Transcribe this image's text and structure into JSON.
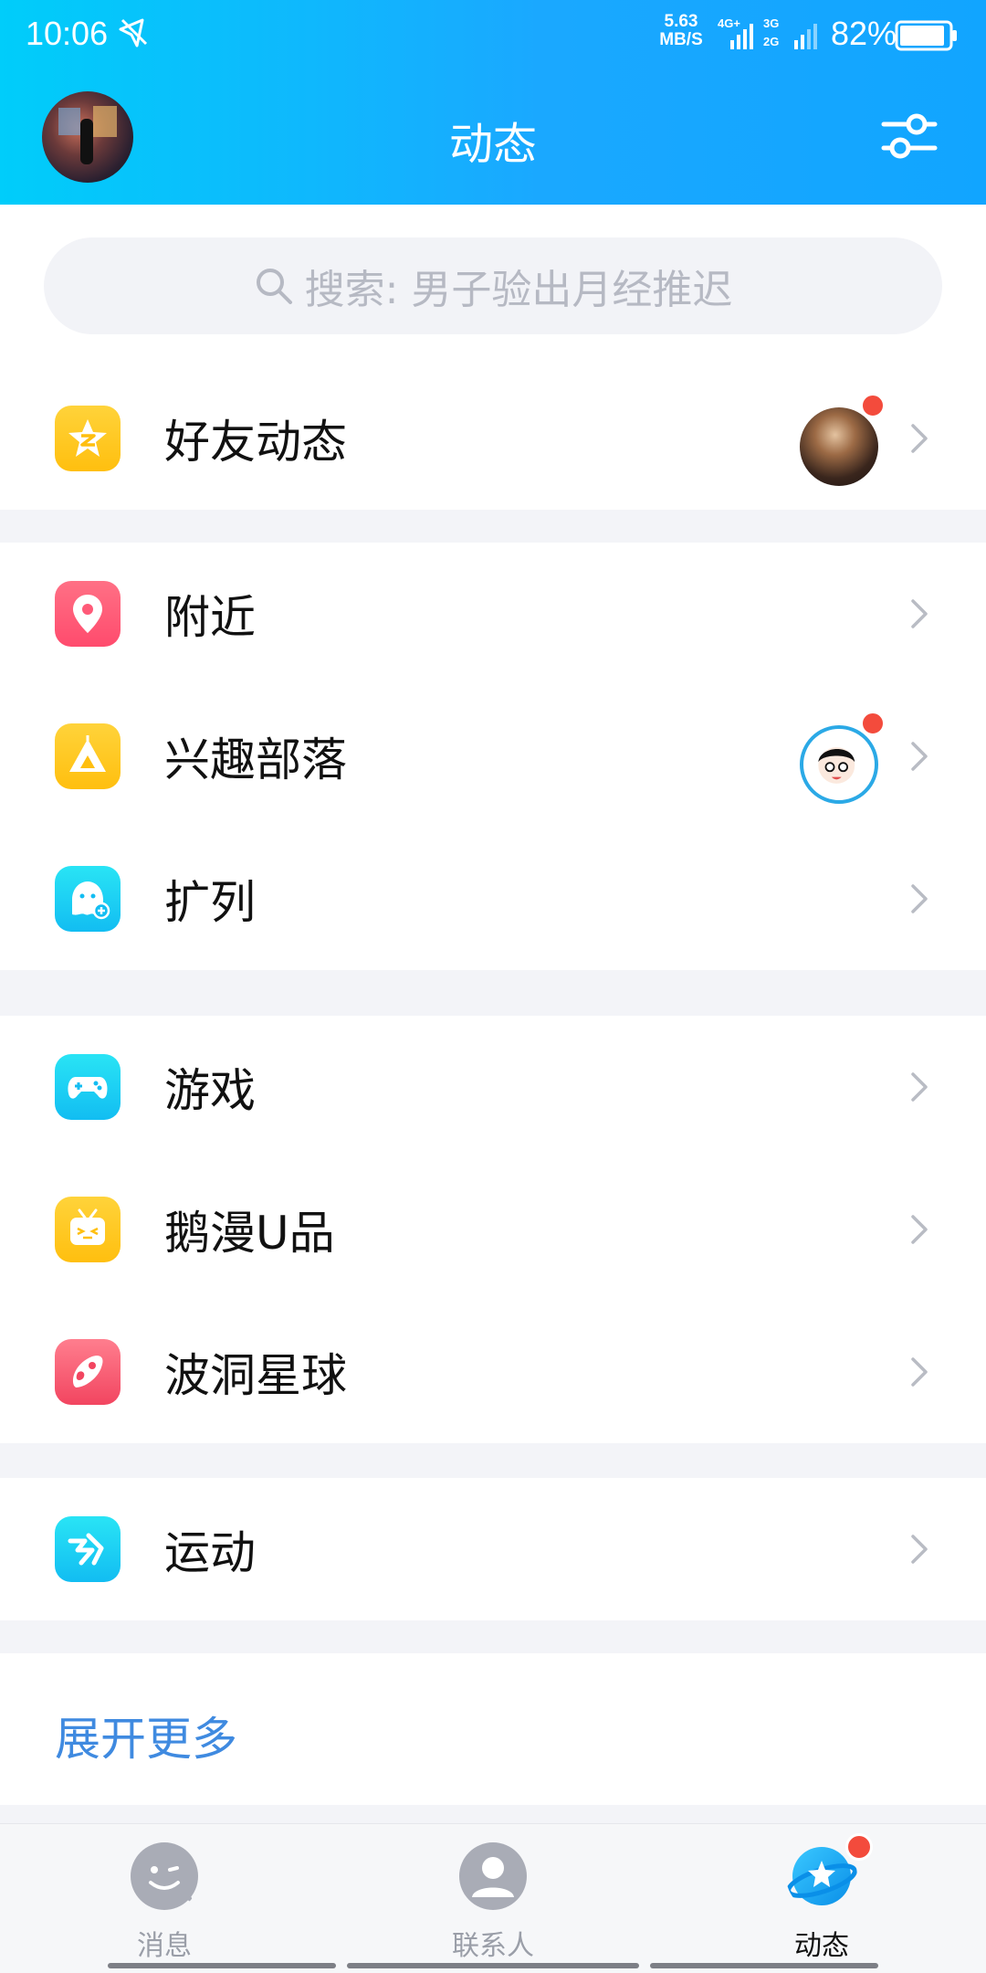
{
  "status_bar": {
    "time": "10:06",
    "speed_value": "5.63",
    "speed_unit": "MB/S",
    "network1": "4G+",
    "network2_top": "3G",
    "network2_bottom": "2G",
    "battery_percent": "82%"
  },
  "header": {
    "title": "动态"
  },
  "search": {
    "placeholder": "搜索: 男子验出月经推迟"
  },
  "groups": [
    {
      "items": [
        {
          "label": "好友动态",
          "icon": "qzone-star-icon",
          "icon_color": "#ffc61f",
          "has_thumb": true,
          "has_badge": true
        }
      ]
    },
    {
      "items": [
        {
          "label": "附近",
          "icon": "location-pin-icon",
          "icon_color": "#ff5a78",
          "has_thumb": false,
          "has_badge": false
        },
        {
          "label": "兴趣部落",
          "icon": "tent-icon",
          "icon_color": "#ffc61f",
          "has_thumb": true,
          "has_badge": true
        },
        {
          "label": "扩列",
          "icon": "ghost-plus-icon",
          "icon_color": "#1ccff4",
          "has_thumb": false,
          "has_badge": false
        }
      ]
    },
    {
      "items": [
        {
          "label": "游戏",
          "icon": "gamepad-icon",
          "icon_color": "#1ccff4",
          "has_thumb": false,
          "has_badge": false
        },
        {
          "label": "鹅漫U品",
          "icon": "tv-face-icon",
          "icon_color": "#ffc61f",
          "has_thumb": false,
          "has_badge": false
        },
        {
          "label": "波洞星球",
          "icon": "planet-rocket-icon",
          "icon_color": "#f5546b",
          "has_thumb": false,
          "has_badge": false
        }
      ]
    },
    {
      "items": [
        {
          "label": "运动",
          "icon": "runner-icon",
          "icon_color": "#1ccff4",
          "has_thumb": false,
          "has_badge": false
        }
      ]
    }
  ],
  "expand": {
    "label": "展开更多"
  },
  "bottom_nav": [
    {
      "label": "消息",
      "icon": "message-face-icon",
      "active": false
    },
    {
      "label": "联系人",
      "icon": "contacts-person-icon",
      "active": false
    },
    {
      "label": "动态",
      "icon": "star-planet-icon",
      "active": true,
      "has_badge": true
    }
  ],
  "colors": {
    "header_gradient_start": "#00cdfa",
    "header_gradient_end": "#11a5ff",
    "link_blue": "#3f8ae0",
    "badge_red": "#f34b3c"
  }
}
